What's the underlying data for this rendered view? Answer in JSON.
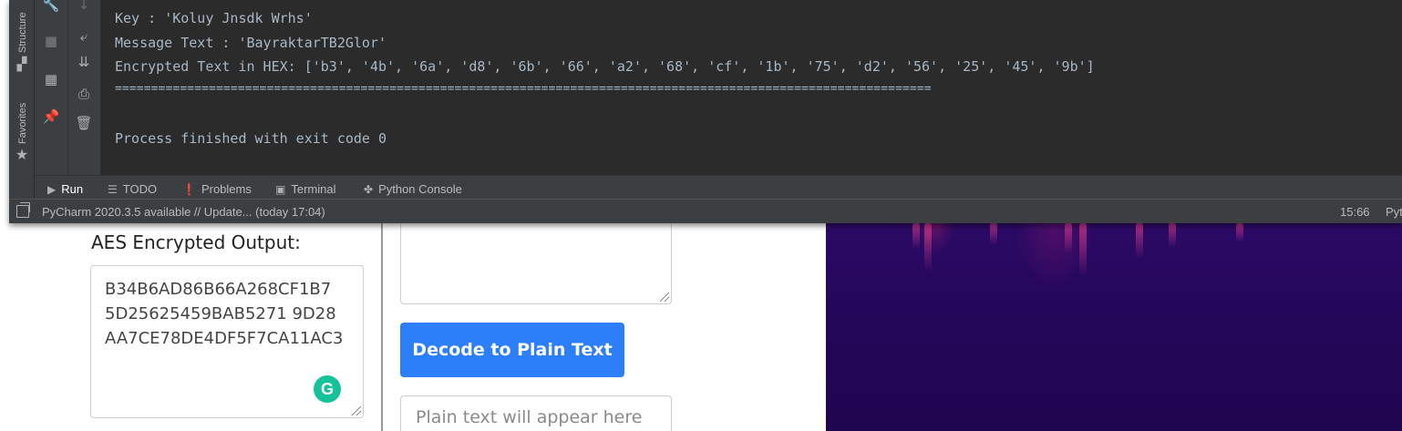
{
  "ide": {
    "side_labels": {
      "structure": "Structure",
      "favorites": "Favorites"
    },
    "console_lines": [
      "Key : 'Koluy Jnsdk Wrhs'",
      "Message Text : 'BayraktarTB2Glor'",
      "Encrypted Text in HEX: ['b3', '4b', '6a', 'd8', '6b', '66', 'a2', '68', 'cf', '1b', '75', 'd2', '56', '25', '45', '9b']",
      "=================================================================================================================",
      "",
      "Process finished with exit code 0"
    ],
    "tabs": [
      {
        "label": "Run",
        "icon": "play-icon",
        "glyph": "▶"
      },
      {
        "label": "TODO",
        "icon": "list-icon",
        "glyph": "☰"
      },
      {
        "label": "Problems",
        "icon": "warning-icon",
        "glyph": "❗"
      },
      {
        "label": "Terminal",
        "icon": "terminal-icon",
        "glyph": "▣"
      },
      {
        "label": "Python Console",
        "icon": "python-icon",
        "glyph": "✤"
      }
    ],
    "status": {
      "message": "PyCharm 2020.3.5 available // Update... (today 17:04)",
      "position": "15:66",
      "right_text": "Pyt"
    }
  },
  "page": {
    "aes_label": "AES Encrypted Output:",
    "aes_output": "B34B6AD86B66A268CF1B7\n5D25625459BAB5271 9D28\nAA7CE78DE4DF5F7CA11AC3",
    "grammarly_letter": "G",
    "decode_button": "Decode to Plain Text",
    "plain_placeholder": "Plain text will appear here"
  },
  "colors": {
    "button_blue": "#2d7ff9",
    "ide_bg": "#2b2b2b",
    "console_text": "#a9b7c6",
    "grammarly_green": "#15c39a",
    "background_purple": "#24075a"
  }
}
